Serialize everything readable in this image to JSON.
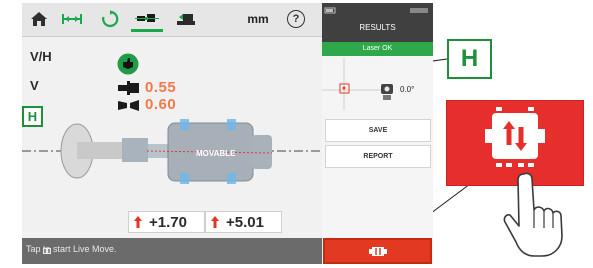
{
  "toolbar": {
    "unit_label": "mm",
    "help_label": "?"
  },
  "axes": {
    "vh_label": "V/H",
    "v_label": "V",
    "h_label": "H"
  },
  "readings": {
    "offset": "0.55",
    "angle": "0.60"
  },
  "machine": {
    "label": "MOVABLE"
  },
  "values": {
    "vertical": "+1.70",
    "horizontal": "+5.01"
  },
  "status": {
    "text": "Tap   to start Live Move."
  },
  "results_panel": {
    "title": "RESULTS",
    "laser_status": "Laser OK",
    "angle_value": "0.0°",
    "save_label": "SAVE",
    "report_label": "REPORT"
  },
  "callouts": {
    "large_h": "H"
  },
  "colors": {
    "accent_green": "#1f8f3a",
    "alert_red": "#e62e2d",
    "reading_orange": "#f07a4a"
  }
}
